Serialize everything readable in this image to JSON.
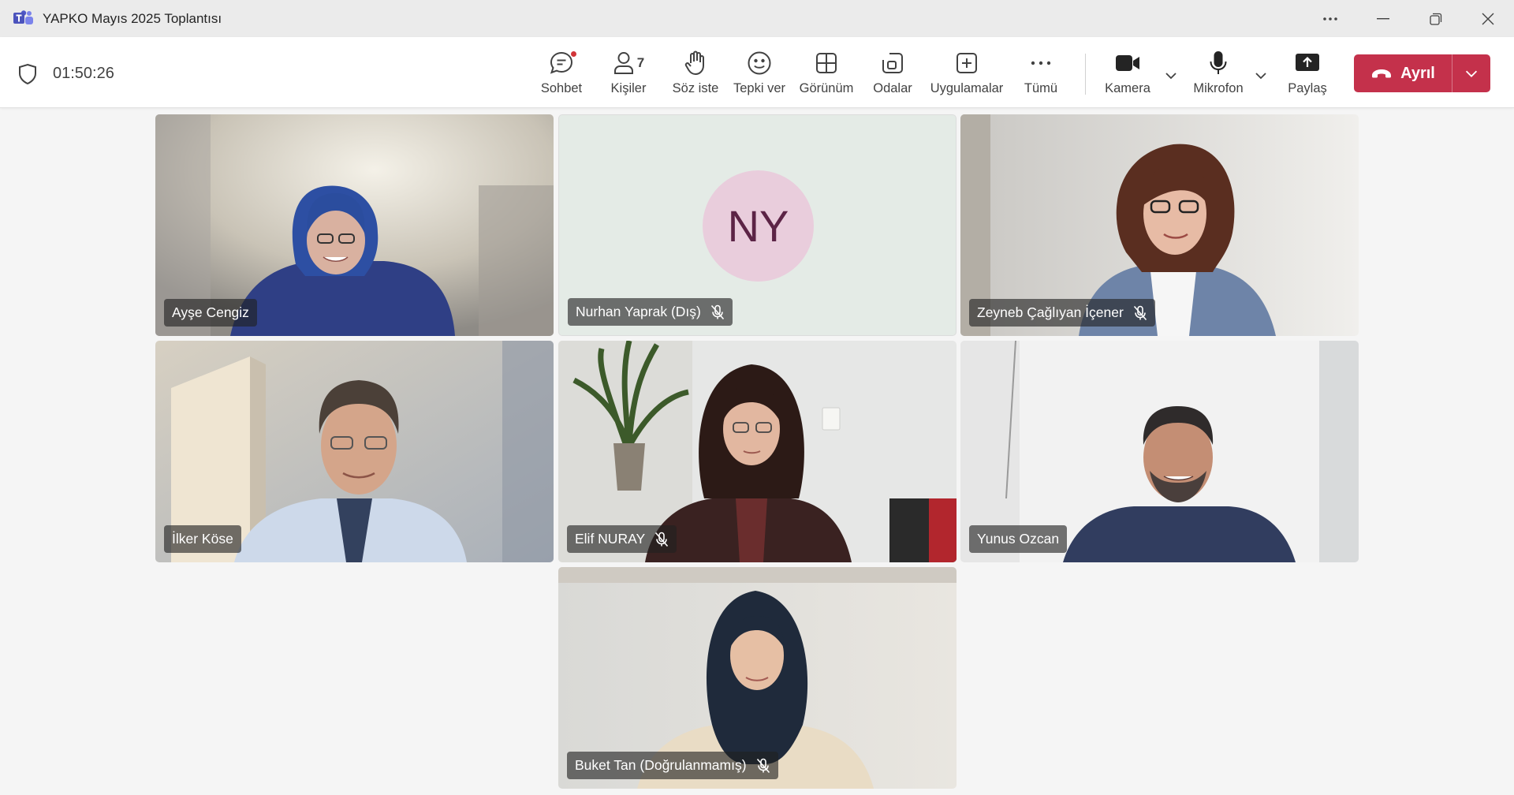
{
  "window": {
    "title": "YAPKO Mayıs 2025 Toplantısı",
    "icons": {
      "app": "teams-icon",
      "more": "more-icon",
      "minimize": "minimize-icon",
      "restore": "restore-icon",
      "close": "close-icon"
    }
  },
  "meeting": {
    "elapsed": "01:50:26",
    "participant_count": "7"
  },
  "toolbar": {
    "chat": "Sohbet",
    "people": "Kişiler",
    "raise_hand": "Söz iste",
    "react": "Tepki ver",
    "view": "Görünüm",
    "rooms": "Odalar",
    "apps": "Uygulamalar",
    "more": "Tümü",
    "camera": "Kamera",
    "mic": "Mikrofon",
    "share": "Paylaş",
    "leave": "Ayrıl"
  },
  "colors": {
    "leave": "#c4314b",
    "unread_dot": "#d13438",
    "avatar_bg": "#e9cddc",
    "avatar_text": "#5c2446"
  },
  "participants": [
    {
      "name": "Ayşe Cengiz",
      "muted": false,
      "video": true
    },
    {
      "name": "Nurhan Yaprak (Dış)",
      "muted": true,
      "video": false,
      "initials": "NY"
    },
    {
      "name": "Zeyneb Çağlıyan İçener",
      "muted": true,
      "video": true
    },
    {
      "name": "İlker Köse",
      "muted": false,
      "video": true
    },
    {
      "name": "Elif NURAY",
      "muted": true,
      "video": true
    },
    {
      "name": "Yunus Ozcan",
      "muted": false,
      "video": true
    },
    {
      "name": "Buket Tan (Doğrulanmamış)",
      "muted": true,
      "video": true
    }
  ]
}
